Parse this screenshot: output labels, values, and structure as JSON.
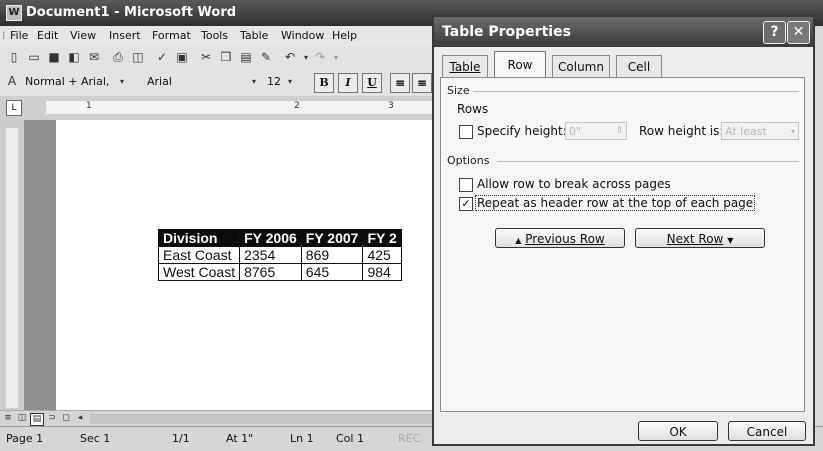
{
  "word": {
    "title": "Document1 - Microsoft Word",
    "menus": [
      "File",
      "Edit",
      "View",
      "Insert",
      "Format",
      "Tools",
      "Table",
      "Window",
      "Help"
    ],
    "style_value": "Normal + Arial,",
    "font_value": "Arial",
    "size_value": "12",
    "ruler_numbers": [
      "1",
      "2",
      "3"
    ],
    "table": {
      "headers": [
        "Division",
        "FY 2006",
        "FY 2007",
        "FY 2"
      ],
      "rows": [
        [
          "East Coast",
          "2354",
          "869",
          "425"
        ],
        [
          "West Coast",
          "8765",
          "645",
          "984"
        ]
      ]
    },
    "status": {
      "page": "Page 1",
      "sec": "Sec 1",
      "pages": "1/1",
      "at": "At 1\"",
      "ln": "Ln 1",
      "col": "Col 1",
      "rec": "REC"
    }
  },
  "dialog": {
    "title": "Table Properties",
    "help": "?",
    "close": "✕",
    "tabs": [
      "Table",
      "Row",
      "Column",
      "Cell"
    ],
    "active_tab": "Row",
    "size_group": "Size",
    "rows_label": "Rows",
    "specify_height_label": "Specify height:",
    "specify_height_checked": false,
    "height_value": "0\"",
    "row_height_is_label": "Row height is:",
    "row_height_is_value": "At least",
    "options_group": "Options",
    "allow_break_label": "Allow row to break across pages",
    "allow_break_checked": false,
    "repeat_header_label": "Repeat as header row at the top of each page",
    "repeat_header_checked": true,
    "previous_row": "Previous Row",
    "next_row": "Next Row",
    "ok": "OK",
    "cancel": "Cancel"
  }
}
